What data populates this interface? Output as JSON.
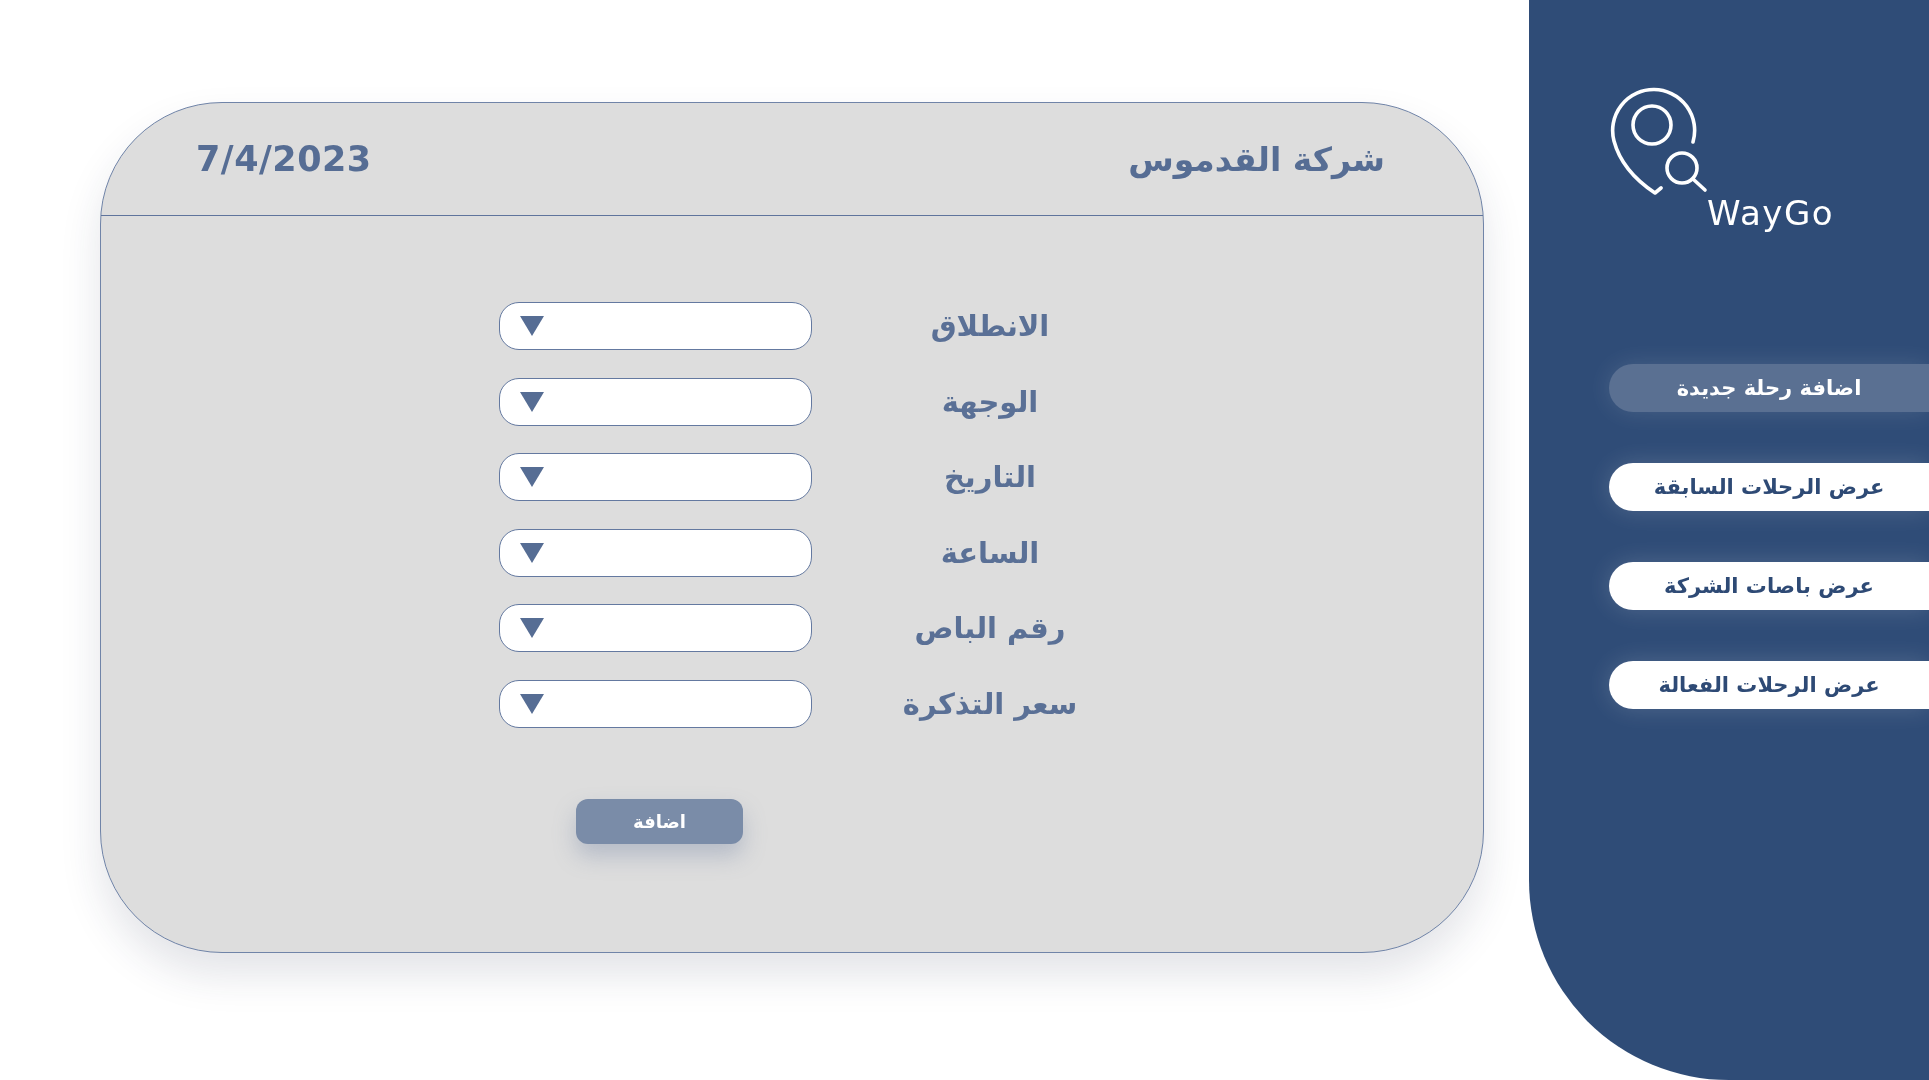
{
  "card": {
    "title": "شركة القدموس",
    "date": "7/4/2023"
  },
  "form": {
    "fields": [
      {
        "label": "الانطلاق"
      },
      {
        "label": "الوجهة"
      },
      {
        "label": "التاريخ"
      },
      {
        "label": "الساعة"
      },
      {
        "label": "رقم الباص"
      },
      {
        "label": "سعر التذكرة"
      }
    ],
    "submit": "اضافة"
  },
  "sidebar": {
    "logo": "WayGo",
    "menu": [
      {
        "label": "اضافة رحلة جديدة",
        "selected": true
      },
      {
        "label": "عرض الرحلات السابقة",
        "selected": false
      },
      {
        "label": "عرض باصات الشركة",
        "selected": false
      },
      {
        "label": "عرض الرحلات الفعالة",
        "selected": false
      }
    ]
  }
}
